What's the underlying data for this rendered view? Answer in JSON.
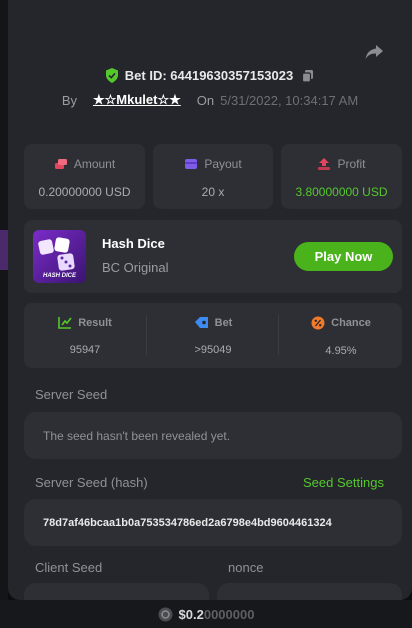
{
  "bet": {
    "id_label": "Bet ID: 6441963035715302​3",
    "by_label": "By",
    "user": "★☆Mkulet☆★",
    "on_label": "On",
    "date": "5/31/2022, 10:34:17 AM"
  },
  "stats": [
    {
      "label": "Amount",
      "value": "0.20000000 USD",
      "icon": "coins-icon"
    },
    {
      "label": "Payout",
      "value": "20 x",
      "icon": "wallet-icon"
    },
    {
      "label": "Profit",
      "value": "3.80000000 USD",
      "icon": "profit-icon"
    }
  ],
  "game": {
    "title": "Hash Dice",
    "subtitle": "BC Original",
    "thumb_text": "HASH DICE",
    "play_label": "Play Now"
  },
  "results": [
    {
      "label": "Result",
      "value": "95947",
      "icon": "result-icon"
    },
    {
      "label": "Bet",
      "value": ">95049",
      "icon": "bet-tag-icon"
    },
    {
      "label": "Chance",
      "value": "4.95%",
      "icon": "percent-icon"
    }
  ],
  "seeds": {
    "server_seed_label": "Server Seed",
    "server_seed_value": "The seed hasn't been revealed yet.",
    "server_hash_label": "Server Seed (hash)",
    "seed_settings_label": "Seed Settings",
    "server_hash_value": "78d7af46bcaa1b0a753534786ed2a6798e4bd9604461324",
    "client_seed_label": "Client Seed",
    "nonce_label": "nonce"
  },
  "footer": {
    "balance_main": "$0.2",
    "balance_faded": "0000000"
  },
  "colors": {
    "accent_green": "#55c82c",
    "play_button": "#4ab21a",
    "card_bg": "#2d2f35",
    "modal_bg": "#24262b"
  }
}
